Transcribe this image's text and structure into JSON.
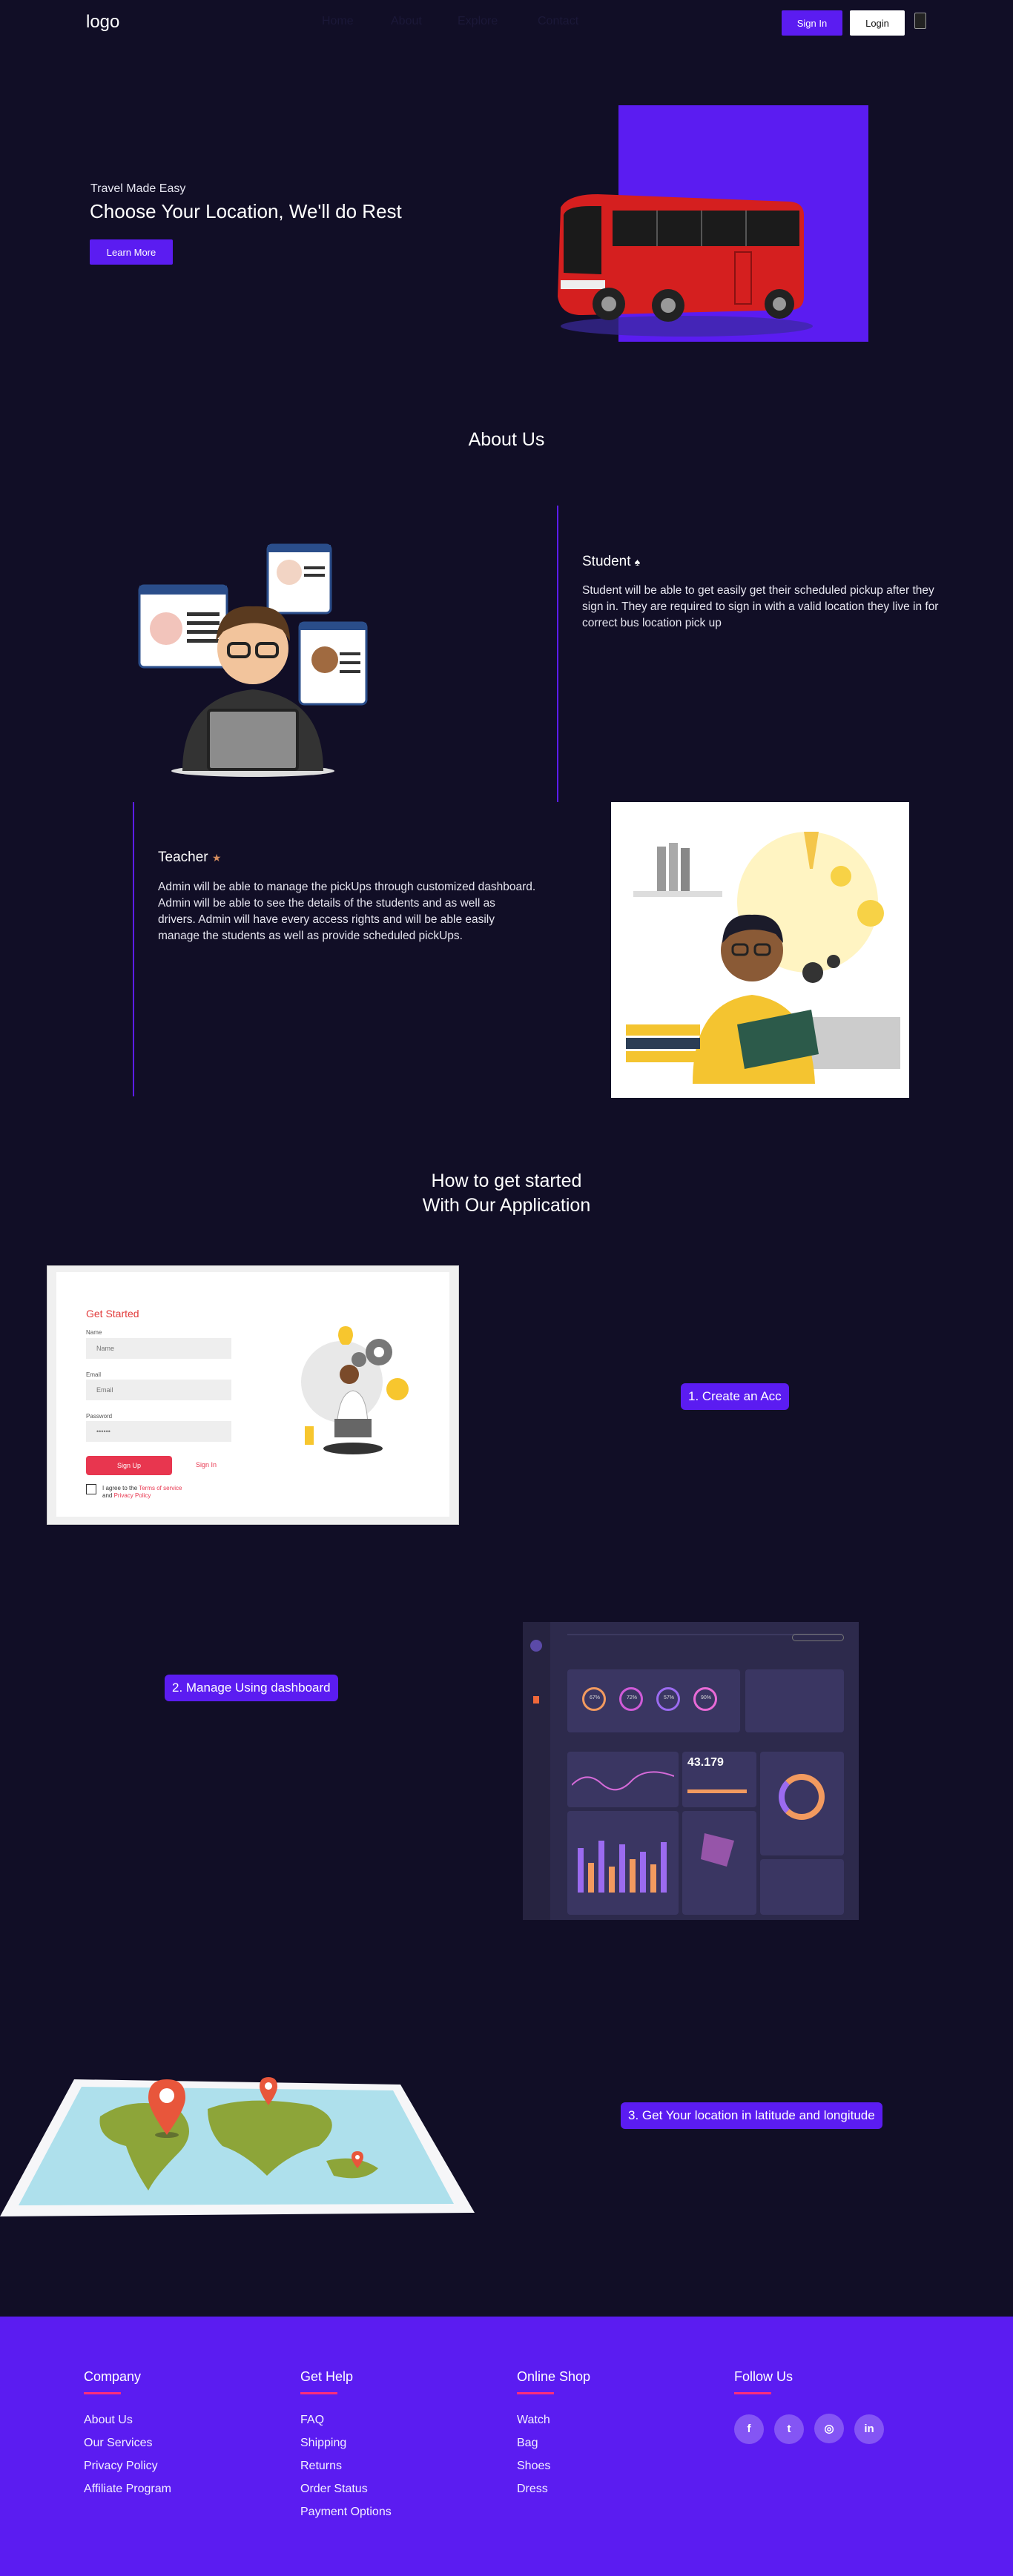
{
  "nav": {
    "logo": "logo",
    "links": [
      "Home",
      "About",
      "Explore",
      "Contact"
    ],
    "signin_label": "Sign In",
    "login_label": "Login"
  },
  "hero": {
    "tagline": "Travel Made Easy",
    "title": "Choose Your Location, We'll do Rest",
    "button_label": "Learn More"
  },
  "about": {
    "heading": "About Us",
    "student": {
      "title": "Student",
      "text": "Student will be able to get easily get their scheduled pickup after they sign in. They are required to sign in with a valid location they live in for correct bus location pick up"
    },
    "teacher": {
      "title": "Teacher",
      "text": "Admin will be able to manage the pickUps through customized dashboard. Admin will be able to see the details of the students and as well as drivers. Admin will have every access rights and will be able easily manage the students as well as provide scheduled pickUps."
    }
  },
  "started": {
    "heading_line1": "How to get started",
    "heading_line2": "With Our Application",
    "steps": [
      {
        "label": "1.   Create an Acc"
      },
      {
        "label": "2.   Manage Using dashboard"
      },
      {
        "label": "3.   Get Your location in latitude and longitude"
      }
    ],
    "signup_form": {
      "title": "Get Started",
      "name_label": "Name",
      "name_placeholder": "Name",
      "email_label": "Email",
      "email_placeholder": "Email",
      "password_label": "Password",
      "password_placeholder": "••••••",
      "signup_button": "Sign Up",
      "signin_link": "Sign In",
      "agree_prefix": "I agree to the ",
      "terms": "Terms of service",
      "and": "and ",
      "privacy": "Privacy Policy"
    },
    "dashboard": {
      "kpi": "43.179",
      "ring_labels": [
        "67%",
        "72%",
        "57%",
        "90%"
      ]
    }
  },
  "footer": {
    "columns": [
      {
        "title": "Company",
        "links": [
          "About Us",
          "Our Services",
          "Privacy Policy",
          "Affiliate Program"
        ]
      },
      {
        "title": "Get Help",
        "links": [
          "FAQ",
          "Shipping",
          "Returns",
          "Order Status",
          "Payment Options"
        ]
      },
      {
        "title": "Online Shop",
        "links": [
          "Watch",
          "Bag",
          "Shoes",
          "Dress"
        ]
      },
      {
        "title": "Follow Us",
        "links": []
      }
    ],
    "social": [
      {
        "icon": "facebook-icon",
        "glyph": "f"
      },
      {
        "icon": "twitter-icon",
        "glyph": "t"
      },
      {
        "icon": "instagram-icon",
        "glyph": "◎"
      },
      {
        "icon": "linkedin-icon",
        "glyph": "in"
      }
    ]
  },
  "colors": {
    "background": "#110e26",
    "accent": "#5b1cf1",
    "pink": "#ff2e79"
  }
}
